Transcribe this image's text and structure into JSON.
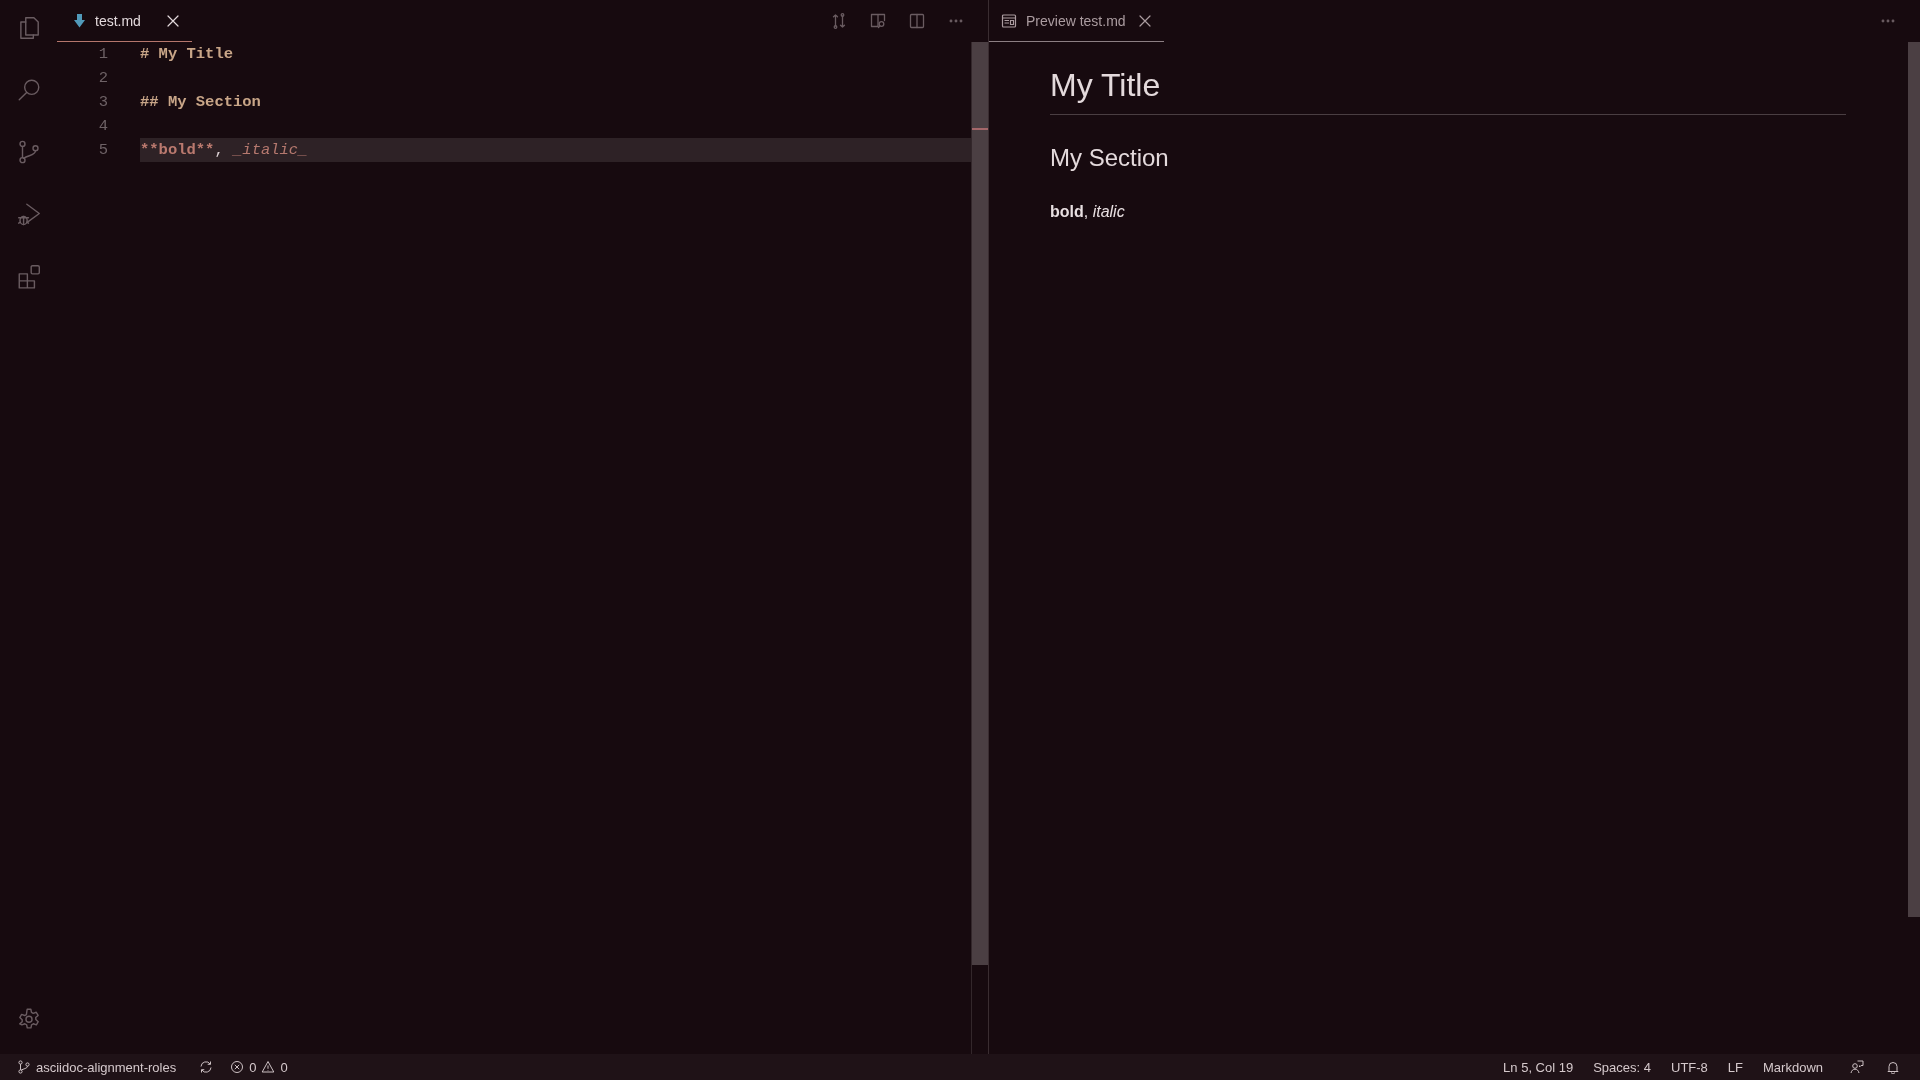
{
  "editor": {
    "tabs": [
      {
        "label": "test.md",
        "selected": true
      }
    ],
    "lines": [
      {
        "number": "1",
        "current": false,
        "tokens": [
          {
            "kind": "heading",
            "text": "# My Title"
          }
        ]
      },
      {
        "number": "2",
        "current": false
      },
      {
        "number": "3",
        "current": false,
        "tokens": [
          {
            "kind": "heading",
            "text": "## My Section"
          }
        ]
      },
      {
        "number": "4",
        "current": false
      },
      {
        "number": "5",
        "current": true,
        "tokens": [
          {
            "kind": "bold",
            "text": "**bold**"
          },
          {
            "kind": "plain",
            "text": ", "
          },
          {
            "kind": "italic",
            "text": "_italic_"
          }
        ]
      }
    ]
  },
  "preview": {
    "tabs": [
      {
        "label": "Preview test.md",
        "selected": true
      }
    ],
    "title": "My Title",
    "section": "My Section",
    "paragraph": "**bold**, *italic*"
  },
  "status_bar": {
    "branch": "asciidoc-alignment-roles",
    "errors": "0",
    "warnings": "0",
    "items": [
      "Ln 5, Col 19",
      "Spaces: 4",
      "UTF-8",
      "LF",
      "Markdown"
    ]
  }
}
